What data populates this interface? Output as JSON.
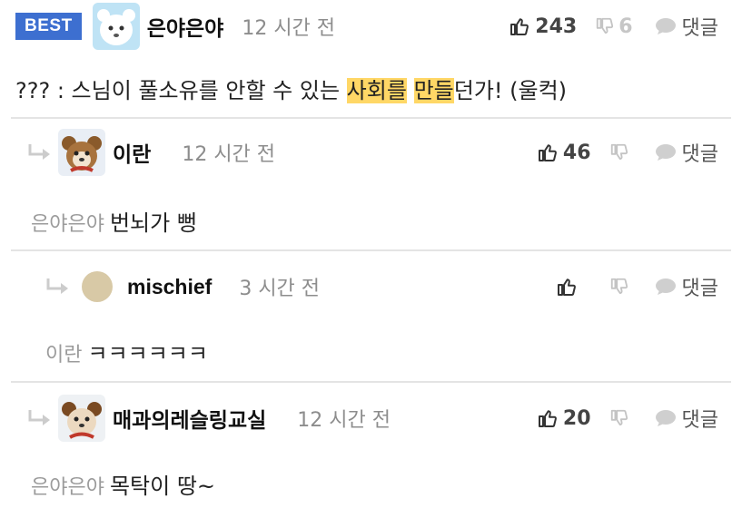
{
  "comments": [
    {
      "badge": "BEST",
      "author": "은야은야",
      "time": "12 시간 전",
      "likes": "243",
      "dislikes": "6",
      "reply_label": "댓글",
      "text_before": "??? : 스님이 풀소유를 안할 수 있는 ",
      "text_hl1": "사회를",
      "text_mid": " ",
      "text_hl2": "만들",
      "text_after": "던가! (울컥)"
    },
    {
      "author": "이란",
      "time": "12 시간 전",
      "likes": "46",
      "dislikes": "",
      "reply_label": "댓글",
      "mention": "은야은야",
      "text": "번뇌가 뻥"
    },
    {
      "author": "mischief",
      "time": "3 시간 전",
      "likes": "",
      "dislikes": "",
      "reply_label": "댓글",
      "mention": "이란",
      "text": "ㅋㅋㅋㅋㅋㅋ"
    },
    {
      "author": "매과의레슬링교실",
      "time": "12 시간 전",
      "likes": "20",
      "dislikes": "",
      "reply_label": "댓글",
      "mention": "은야은야",
      "text": "목탁이 땅~"
    }
  ],
  "colors": {
    "badge": "#3d6fd0",
    "highlight": "#ffd766",
    "divider": "#e4e4e4"
  }
}
